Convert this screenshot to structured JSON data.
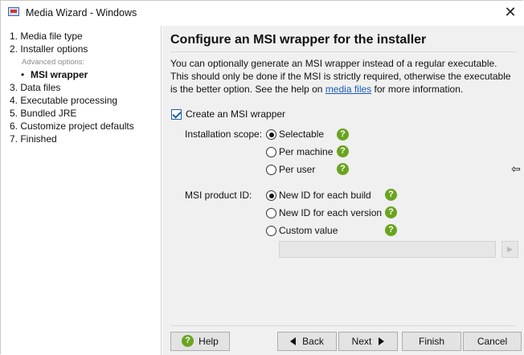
{
  "window": {
    "title": "Media Wizard - Windows"
  },
  "nav": {
    "items": [
      {
        "label": "1. Media file type"
      },
      {
        "label": "2. Installer options"
      },
      {
        "label": "3. Data files"
      },
      {
        "label": "4. Executable processing"
      },
      {
        "label": "5. Bundled JRE"
      },
      {
        "label": "6. Customize project defaults"
      },
      {
        "label": "7. Finished"
      }
    ],
    "advanced_label": "Advanced options:",
    "current_label": "MSI wrapper"
  },
  "main": {
    "title": "Configure an MSI wrapper for the installer",
    "description_before_link": "You can optionally generate an MSI wrapper instead of a regular executable. This should only be done if the MSI is strictly required, otherwise the executable is the better option. See the help on ",
    "description_link": "media files",
    "description_after_link": " for more information.",
    "create_msi_label": "Create an MSI wrapper",
    "create_msi_checked": true,
    "installation_scope": {
      "label": "Installation scope:",
      "options": [
        "Selectable",
        "Per machine",
        "Per user"
      ],
      "selected": "Selectable"
    },
    "product_id": {
      "label": "MSI product ID:",
      "options": [
        "New ID for each build",
        "New ID for each version",
        "Custom value"
      ],
      "selected": "New ID for each build"
    },
    "custom_value": ""
  },
  "buttons": {
    "help": "Help",
    "back": "Back",
    "next": "Next",
    "finish": "Finish",
    "cancel": "Cancel"
  },
  "colors": {
    "accent": "#1e5fa8",
    "help_icon": "#6aa41f",
    "link": "#1a5bb8",
    "panel_bg": "#f0f0f0"
  }
}
